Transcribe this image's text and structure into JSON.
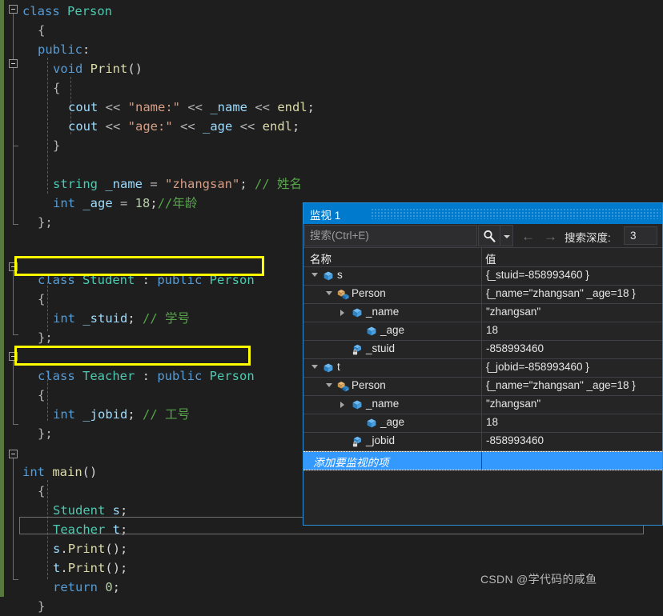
{
  "editor": {
    "lines": [
      {
        "indent": 0,
        "tokens": [
          {
            "t": "class ",
            "c": "kw"
          },
          {
            "t": "Person",
            "c": "typ"
          }
        ]
      },
      {
        "indent": 1,
        "tokens": [
          {
            "t": "{",
            "c": "op"
          }
        ]
      },
      {
        "indent": 1,
        "tokens": [
          {
            "t": "public",
            "c": "kw"
          },
          {
            "t": ":",
            "c": "pl"
          }
        ]
      },
      {
        "indent": 2,
        "tokens": [
          {
            "t": "void ",
            "c": "kw"
          },
          {
            "t": "Print",
            "c": "fn"
          },
          {
            "t": "()",
            "c": "pl"
          }
        ]
      },
      {
        "indent": 2,
        "tokens": [
          {
            "t": "{",
            "c": "op"
          }
        ]
      },
      {
        "indent": 3,
        "tokens": [
          {
            "t": "cout ",
            "c": "var"
          },
          {
            "t": "<< ",
            "c": "op"
          },
          {
            "t": "\"name:\"",
            "c": "str"
          },
          {
            "t": " << ",
            "c": "op"
          },
          {
            "t": "_name",
            "c": "var"
          },
          {
            "t": " << ",
            "c": "op"
          },
          {
            "t": "endl",
            "c": "fn"
          },
          {
            "t": ";",
            "c": "pl"
          }
        ]
      },
      {
        "indent": 3,
        "tokens": [
          {
            "t": "cout ",
            "c": "var"
          },
          {
            "t": "<< ",
            "c": "op"
          },
          {
            "t": "\"age:\"",
            "c": "str"
          },
          {
            "t": " << ",
            "c": "op"
          },
          {
            "t": "_age",
            "c": "var"
          },
          {
            "t": " << ",
            "c": "op"
          },
          {
            "t": "endl",
            "c": "fn"
          },
          {
            "t": ";",
            "c": "pl"
          }
        ]
      },
      {
        "indent": 2,
        "tokens": [
          {
            "t": "}",
            "c": "op"
          }
        ]
      },
      {
        "indent": 0,
        "tokens": []
      },
      {
        "indent": 2,
        "tokens": [
          {
            "t": "string ",
            "c": "typ"
          },
          {
            "t": "_name ",
            "c": "var"
          },
          {
            "t": "= ",
            "c": "op"
          },
          {
            "t": "\"zhangsan\"",
            "c": "str"
          },
          {
            "t": "; ",
            "c": "pl"
          },
          {
            "t": "// 姓名",
            "c": "cmt"
          }
        ]
      },
      {
        "indent": 2,
        "tokens": [
          {
            "t": "int ",
            "c": "kw"
          },
          {
            "t": "_age ",
            "c": "var"
          },
          {
            "t": "= ",
            "c": "op"
          },
          {
            "t": "18",
            "c": "num"
          },
          {
            "t": ";",
            "c": "pl"
          },
          {
            "t": "//年龄",
            "c": "cmt"
          }
        ]
      },
      {
        "indent": 1,
        "tokens": [
          {
            "t": "};",
            "c": "op"
          }
        ]
      },
      {
        "indent": 0,
        "tokens": []
      },
      {
        "indent": 0,
        "tokens": []
      },
      {
        "indent": 1,
        "tokens": [
          {
            "t": "class ",
            "c": "kw"
          },
          {
            "t": "Student ",
            "c": "typ"
          },
          {
            "t": ": ",
            "c": "pl"
          },
          {
            "t": "public ",
            "c": "kw"
          },
          {
            "t": "Person",
            "c": "typ"
          }
        ]
      },
      {
        "indent": 1,
        "tokens": [
          {
            "t": "{",
            "c": "op"
          }
        ]
      },
      {
        "indent": 2,
        "tokens": [
          {
            "t": "int ",
            "c": "kw"
          },
          {
            "t": "_stuid",
            "c": "var"
          },
          {
            "t": "; ",
            "c": "pl"
          },
          {
            "t": "// 学号",
            "c": "cmt"
          }
        ]
      },
      {
        "indent": 1,
        "tokens": [
          {
            "t": "};",
            "c": "op"
          }
        ]
      },
      {
        "indent": 0,
        "tokens": []
      },
      {
        "indent": 1,
        "tokens": [
          {
            "t": "class ",
            "c": "kw"
          },
          {
            "t": "Teacher ",
            "c": "typ"
          },
          {
            "t": ": ",
            "c": "pl"
          },
          {
            "t": "public ",
            "c": "kw"
          },
          {
            "t": "Person",
            "c": "typ"
          }
        ]
      },
      {
        "indent": 1,
        "tokens": [
          {
            "t": "{",
            "c": "op"
          }
        ]
      },
      {
        "indent": 2,
        "tokens": [
          {
            "t": "int ",
            "c": "kw"
          },
          {
            "t": "_jobid",
            "c": "var"
          },
          {
            "t": "; ",
            "c": "pl"
          },
          {
            "t": "// 工号",
            "c": "cmt"
          }
        ]
      },
      {
        "indent": 1,
        "tokens": [
          {
            "t": "};",
            "c": "op"
          }
        ]
      },
      {
        "indent": 0,
        "tokens": []
      },
      {
        "indent": 0,
        "tokens": [
          {
            "t": "int ",
            "c": "kw"
          },
          {
            "t": "main",
            "c": "fn"
          },
          {
            "t": "()",
            "c": "pl"
          }
        ]
      },
      {
        "indent": 1,
        "tokens": [
          {
            "t": "{",
            "c": "op"
          }
        ]
      },
      {
        "indent": 2,
        "tokens": [
          {
            "t": "Student ",
            "c": "typ"
          },
          {
            "t": "s",
            "c": "var"
          },
          {
            "t": ";",
            "c": "pl"
          }
        ]
      },
      {
        "indent": 2,
        "tokens": [
          {
            "t": "Teacher ",
            "c": "typ"
          },
          {
            "t": "t",
            "c": "var"
          },
          {
            "t": ";",
            "c": "pl"
          }
        ]
      },
      {
        "indent": 2,
        "tokens": [
          {
            "t": "s",
            "c": "var"
          },
          {
            "t": ".",
            "c": "pl"
          },
          {
            "t": "Print",
            "c": "fn"
          },
          {
            "t": "();",
            "c": "pl"
          }
        ]
      },
      {
        "indent": 2,
        "tokens": [
          {
            "t": "t",
            "c": "var"
          },
          {
            "t": ".",
            "c": "pl"
          },
          {
            "t": "Print",
            "c": "fn"
          },
          {
            "t": "();",
            "c": "pl"
          }
        ]
      },
      {
        "indent": 2,
        "tokens": [
          {
            "t": "return ",
            "c": "kw"
          },
          {
            "t": "0",
            "c": "num"
          },
          {
            "t": ";",
            "c": "pl"
          }
        ]
      },
      {
        "indent": 1,
        "tokens": [
          {
            "t": "}",
            "c": "op"
          }
        ]
      }
    ],
    "highlight_color": "#ffff00",
    "change_bar_color": "#57793d"
  },
  "watch": {
    "tab_title": "监视 1",
    "search": {
      "placeholder": "搜索(Ctrl+E)",
      "value": "",
      "search_icon": "magnifier-icon",
      "dropdown_icon": "chevron-down-icon",
      "prev_icon": "arrow-left-icon",
      "next_icon": "arrow-right-icon",
      "depth_label": "搜索深度:",
      "depth_value": "3"
    },
    "columns": [
      "名称",
      "值"
    ],
    "rows": [
      {
        "depth": 0,
        "twist": "open",
        "icon": "field-cube-icon",
        "name": "s",
        "value": "{_stuid=-858993460 }",
        "selected": false
      },
      {
        "depth": 1,
        "twist": "open",
        "icon": "base-class-icon",
        "name": "Person",
        "value": "{_name=\"zhangsan\" _age=18 }",
        "selected": false
      },
      {
        "depth": 2,
        "twist": "closed",
        "icon": "field-cube-icon",
        "name": "_name",
        "value": "\"zhangsan\"",
        "selected": false
      },
      {
        "depth": 3,
        "twist": "none",
        "icon": "field-cube-icon",
        "name": "_age",
        "value": "18",
        "selected": false
      },
      {
        "depth": 2,
        "twist": "none",
        "icon": "private-field-icon",
        "name": "_stuid",
        "value": "-858993460",
        "selected": false
      },
      {
        "depth": 0,
        "twist": "open",
        "icon": "field-cube-icon",
        "name": "t",
        "value": "{_jobid=-858993460 }",
        "selected": false
      },
      {
        "depth": 1,
        "twist": "open",
        "icon": "base-class-icon",
        "name": "Person",
        "value": "{_name=\"zhangsan\" _age=18 }",
        "selected": false
      },
      {
        "depth": 2,
        "twist": "closed",
        "icon": "field-cube-icon",
        "name": "_name",
        "value": "\"zhangsan\"",
        "selected": false
      },
      {
        "depth": 3,
        "twist": "none",
        "icon": "field-cube-icon",
        "name": "_age",
        "value": "18",
        "selected": false
      },
      {
        "depth": 2,
        "twist": "none",
        "icon": "private-field-icon",
        "name": "_jobid",
        "value": "-858993460",
        "selected": false
      },
      {
        "depth": 0,
        "twist": "none",
        "icon": "none",
        "name": "添加要监视的项",
        "value": "",
        "selected": true
      }
    ]
  },
  "watermark": "CSDN @学代码的咸鱼"
}
